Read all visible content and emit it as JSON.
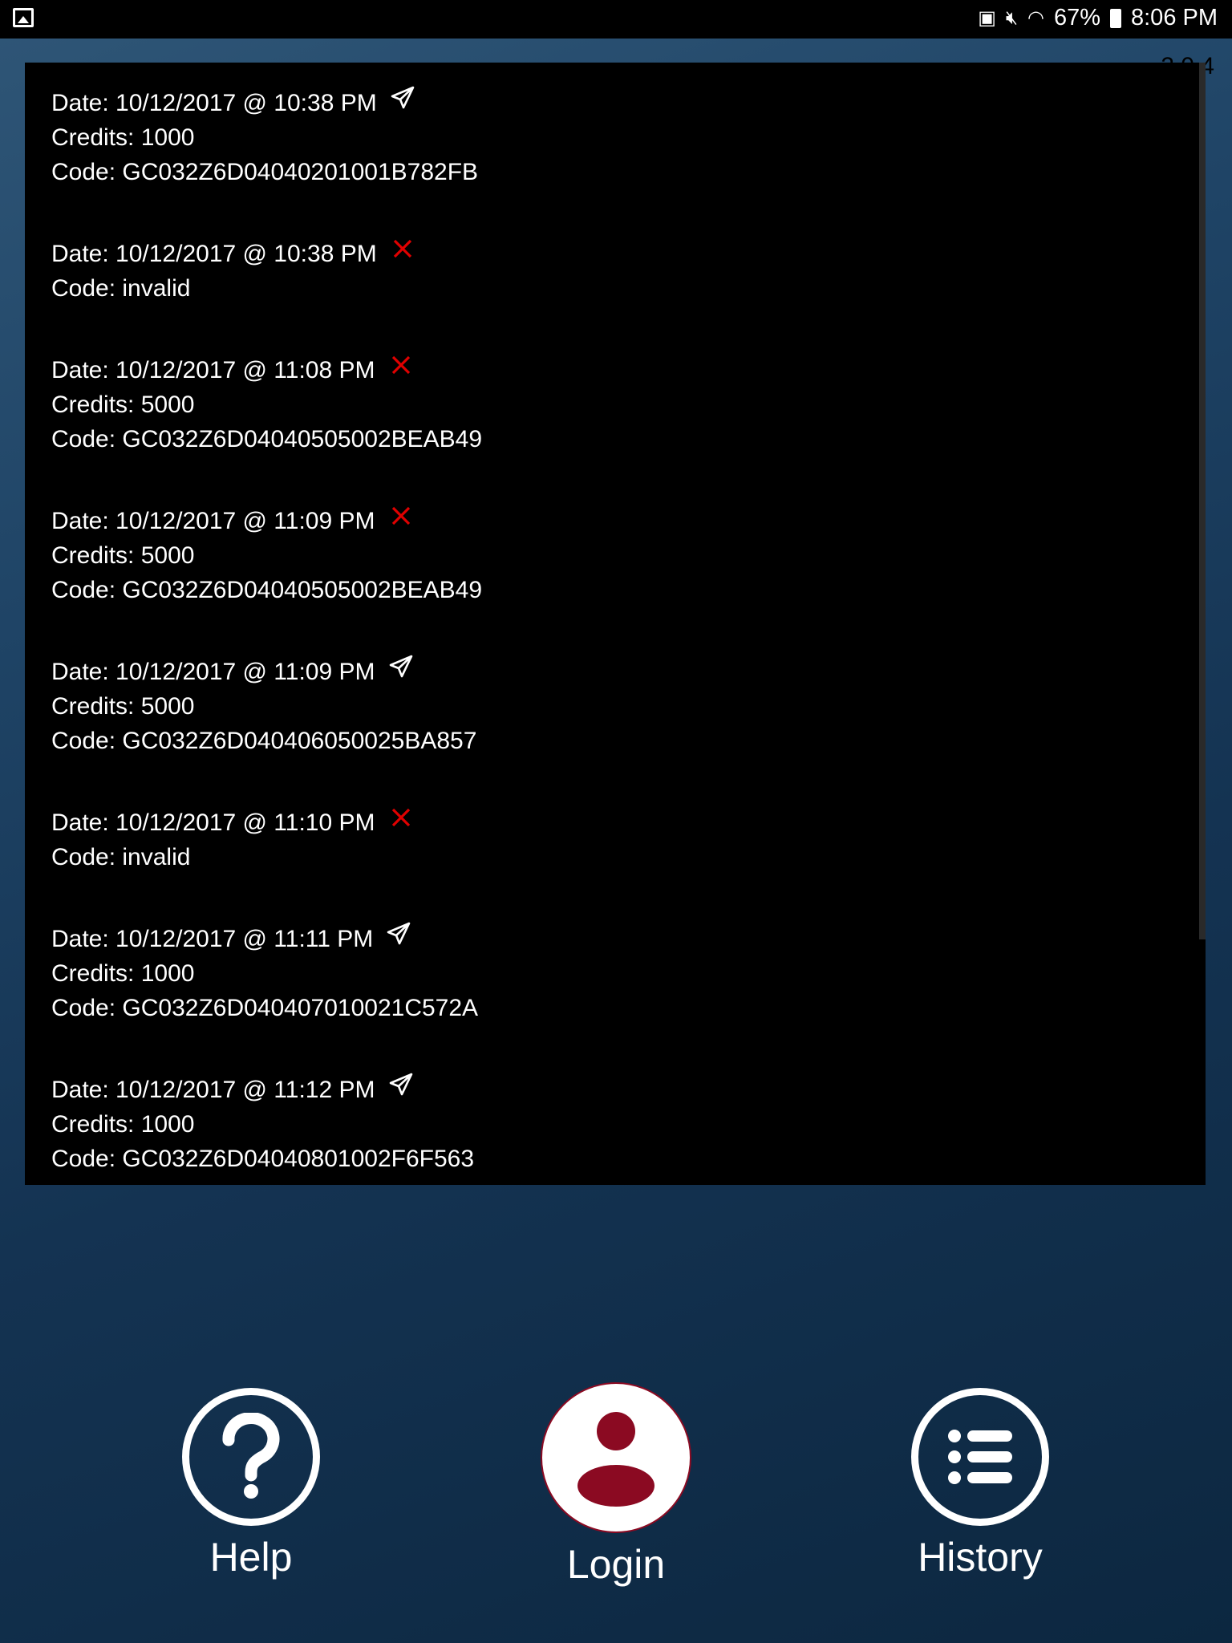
{
  "status_bar": {
    "battery": "67%",
    "time": "8:06 PM",
    "icons": [
      "gallery-icon",
      "battery-saver-icon",
      "mute-icon",
      "wifi-icon",
      "battery-icon"
    ]
  },
  "version": "2.0.4",
  "history": [
    {
      "date": "Date: 10/12/2017 @ 10:38 PM",
      "status": "sent",
      "credits": "Credits: 1000",
      "code": "Code: GC032Z6D04040201001B782FB"
    },
    {
      "date": "Date: 10/12/2017 @ 10:38 PM",
      "status": "failed",
      "code": "Code: invalid"
    },
    {
      "date": "Date: 10/12/2017 @ 11:08 PM",
      "status": "failed",
      "credits": "Credits: 5000",
      "code": "Code: GC032Z6D04040505002BEAB49"
    },
    {
      "date": "Date: 10/12/2017 @ 11:09 PM",
      "status": "failed",
      "credits": "Credits: 5000",
      "code": "Code: GC032Z6D04040505002BEAB49"
    },
    {
      "date": "Date: 10/12/2017 @ 11:09 PM",
      "status": "sent",
      "credits": "Credits: 5000",
      "code": "Code: GC032Z6D040406050025BA857"
    },
    {
      "date": "Date: 10/12/2017 @ 11:10 PM",
      "status": "failed",
      "code": "Code: invalid"
    },
    {
      "date": "Date: 10/12/2017 @ 11:11 PM",
      "status": "sent",
      "credits": "Credits: 1000",
      "code": "Code: GC032Z6D040407010021C572A"
    },
    {
      "date": "Date: 10/12/2017 @ 11:12 PM",
      "status": "sent",
      "credits": "Credits: 1000",
      "code": "Code: GC032Z6D04040801002F6F563"
    }
  ],
  "nav": {
    "help": "Help",
    "login": "Login",
    "history": "History"
  },
  "colors": {
    "failed": "#e00000",
    "login_accent": "#8b0a22",
    "panel": "#000000"
  }
}
